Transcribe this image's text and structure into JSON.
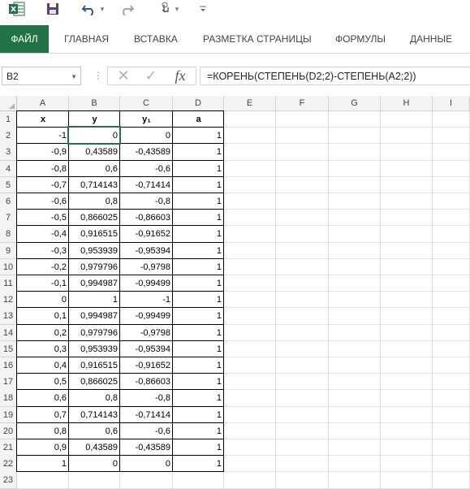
{
  "quick_access": {
    "icons": [
      "excel-icon",
      "save-icon",
      "undo-icon",
      "redo-icon",
      "touch-mode-icon",
      "customize-icon"
    ],
    "undo_dropdown": "▾",
    "touch_dropdown": "▾",
    "customize_glyph": "⫶"
  },
  "ribbon": {
    "tabs": [
      {
        "label": "ФАЙЛ"
      },
      {
        "label": "ГЛАВНАЯ"
      },
      {
        "label": "ВСТАВКА"
      },
      {
        "label": "РАЗМЕТКА СТРАНИЦЫ"
      },
      {
        "label": "ФОРМУЛЫ"
      },
      {
        "label": "ДАННЫЕ"
      }
    ]
  },
  "formula_bar": {
    "name_box": "B2",
    "formula": "=КОРЕНЬ(СТЕПЕНЬ(D2;2)-СТЕПЕНЬ(A2;2))",
    "separator": "⋮",
    "cancel_glyph": "✕",
    "enter_glyph": "✓",
    "fx_label": "fx"
  },
  "sheet": {
    "columns": [
      "A",
      "B",
      "C",
      "D",
      "E",
      "F",
      "G",
      "H",
      "I"
    ],
    "row_numbers": [
      "1",
      "2",
      "3",
      "4",
      "5",
      "6",
      "7",
      "8",
      "9",
      "10",
      "11",
      "12",
      "13",
      "14",
      "15",
      "16",
      "17",
      "18",
      "19",
      "20",
      "21",
      "22",
      "23"
    ],
    "headers": [
      "x",
      "y",
      "y₁",
      "a"
    ],
    "rows": [
      [
        "-1",
        "0",
        "0",
        "1"
      ],
      [
        "-0,9",
        "0,43589",
        "-0,43589",
        "1"
      ],
      [
        "-0,8",
        "0,6",
        "-0,6",
        "1"
      ],
      [
        "-0,7",
        "0,714143",
        "-0,71414",
        "1"
      ],
      [
        "-0,6",
        "0,8",
        "-0,8",
        "1"
      ],
      [
        "-0,5",
        "0,866025",
        "-0,86603",
        "1"
      ],
      [
        "-0,4",
        "0,916515",
        "-0,91652",
        "1"
      ],
      [
        "-0,3",
        "0,953939",
        "-0,95394",
        "1"
      ],
      [
        "-0,2",
        "0,979796",
        "-0,9798",
        "1"
      ],
      [
        "-0,1",
        "0,994987",
        "-0,99499",
        "1"
      ],
      [
        "0",
        "1",
        "-1",
        "1"
      ],
      [
        "0,1",
        "0,994987",
        "-0,99499",
        "1"
      ],
      [
        "0,2",
        "0,979796",
        "-0,9798",
        "1"
      ],
      [
        "0,3",
        "0,953939",
        "-0,95394",
        "1"
      ],
      [
        "0,4",
        "0,916515",
        "-0,91652",
        "1"
      ],
      [
        "0,5",
        "0,866025",
        "-0,86603",
        "1"
      ],
      [
        "0,6",
        "0,8",
        "-0,8",
        "1"
      ],
      [
        "0,7",
        "0,714143",
        "-0,71414",
        "1"
      ],
      [
        "0,8",
        "0,6",
        "-0,6",
        "1"
      ],
      [
        "0,9",
        "0,43589",
        "-0,43589",
        "1"
      ],
      [
        "1",
        "0",
        "0",
        "1"
      ]
    ]
  },
  "colors": {
    "accent": "#217346",
    "header_bg": "#f3f3f3",
    "gridline": "#e1e1e1"
  }
}
